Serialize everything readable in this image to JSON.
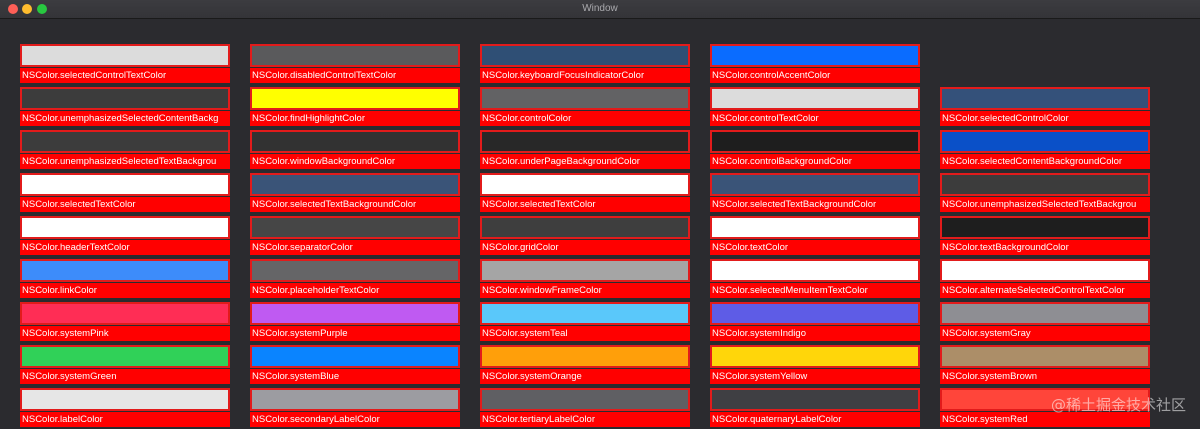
{
  "window": {
    "title": "Window"
  },
  "watermark": "@稀土掘金技术社区",
  "rows": [
    [
      {
        "label": "NSColor.selectedControlTextColor",
        "color": "#dcdcdc"
      },
      {
        "label": "NSColor.disabledControlTextColor",
        "color": "#5a5a5c"
      },
      {
        "label": "NSColor.keyboardFocusIndicatorColor",
        "color": "#2f4f75"
      },
      {
        "label": "NSColor.controlAccentColor",
        "color": "#0a6cff"
      },
      null
    ],
    [
      {
        "label": "NSColor.unemphasizedSelectedContentBackg",
        "color": "#3c3c3c"
      },
      {
        "label": "NSColor.findHighlightColor",
        "color": "#ffff00"
      },
      {
        "label": "NSColor.controlColor",
        "color": "#626264"
      },
      {
        "label": "NSColor.controlTextColor",
        "color": "#dcdcdc"
      },
      {
        "label": "NSColor.selectedControlColor",
        "color": "#34517a"
      }
    ],
    [
      {
        "label": "NSColor.unemphasizedSelectedTextBackgrou",
        "color": "#3c3c3c"
      },
      {
        "label": "NSColor.windowBackgroundColor",
        "color": "#323232"
      },
      {
        "label": "NSColor.underPageBackgroundColor",
        "color": "#282828"
      },
      {
        "label": "NSColor.controlBackgroundColor",
        "color": "#1e1e1e"
      },
      {
        "label": "NSColor.selectedContentBackgroundColor",
        "color": "#0a50c8"
      }
    ],
    [
      {
        "label": "NSColor.selectedTextColor",
        "color": "#ffffff"
      },
      {
        "label": "NSColor.selectedTextBackgroundColor",
        "color": "#3a5478"
      },
      {
        "label": "NSColor.selectedTextColor",
        "color": "#ffffff"
      },
      {
        "label": "NSColor.selectedTextBackgroundColor",
        "color": "#3a5478"
      },
      {
        "label": "NSColor.unemphasizedSelectedTextBackgrou",
        "color": "#3c3c3c"
      }
    ],
    [
      {
        "label": "NSColor.headerTextColor",
        "color": "#ffffff"
      },
      {
        "label": "NSColor.separatorColor",
        "color": "#464646"
      },
      {
        "label": "NSColor.gridColor",
        "color": "#3e3e3e"
      },
      {
        "label": "NSColor.textColor",
        "color": "#ffffff"
      },
      {
        "label": "NSColor.textBackgroundColor",
        "color": "#1e1e1e"
      }
    ],
    [
      {
        "label": "NSColor.linkColor",
        "color": "#3d8cfa"
      },
      {
        "label": "NSColor.placeholderTextColor",
        "color": "#656567"
      },
      {
        "label": "NSColor.windowFrameColor",
        "color": "#a5a5a5"
      },
      {
        "label": "NSColor.selectedMenuItemTextColor",
        "color": "#ffffff"
      },
      {
        "label": "NSColor.alternateSelectedControlTextColor",
        "color": "#ffffff"
      }
    ],
    [
      {
        "label": "NSColor.systemPink",
        "color": "#ff2d55"
      },
      {
        "label": "NSColor.systemPurple",
        "color": "#bf5af2"
      },
      {
        "label": "NSColor.systemTeal",
        "color": "#5ac8fa"
      },
      {
        "label": "NSColor.systemIndigo",
        "color": "#5e5ce6"
      },
      {
        "label": "NSColor.systemGray",
        "color": "#8e8e93"
      }
    ],
    [
      {
        "label": "NSColor.systemGreen",
        "color": "#30d158"
      },
      {
        "label": "NSColor.systemBlue",
        "color": "#0a84ff"
      },
      {
        "label": "NSColor.systemOrange",
        "color": "#ff9f0a"
      },
      {
        "label": "NSColor.systemYellow",
        "color": "#ffd60a"
      },
      {
        "label": "NSColor.systemBrown",
        "color": "#ac8e68"
      }
    ],
    [
      {
        "label": "NSColor.labelColor",
        "color": "#e6e6e6"
      },
      {
        "label": "NSColor.secondaryLabelColor",
        "color": "#9c9ca1"
      },
      {
        "label": "NSColor.tertiaryLabelColor",
        "color": "#5f5f63"
      },
      {
        "label": "NSColor.quaternaryLabelColor",
        "color": "#3f3f43"
      },
      {
        "label": "NSColor.systemRed",
        "color": "#ff453a"
      }
    ]
  ]
}
